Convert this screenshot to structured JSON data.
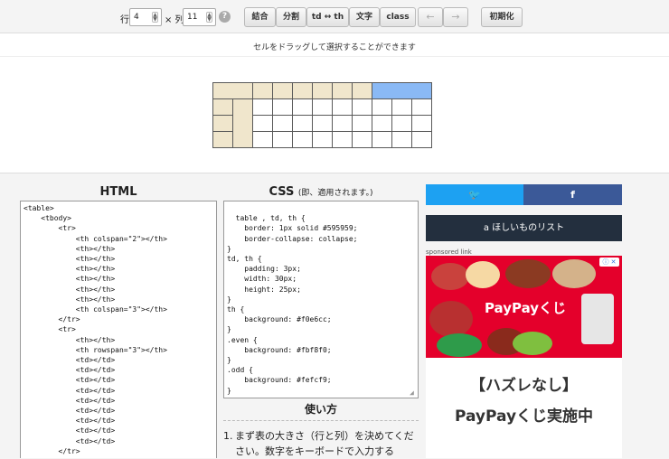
{
  "toolbar": {
    "rows_label": "行",
    "rows_value": "4",
    "times": "× 列",
    "cols_value": "11",
    "help": "?",
    "merge": "結合",
    "split": "分割",
    "td_th": "td ↔ th",
    "text": "文字",
    "class": "class",
    "undo": "←",
    "redo": "→",
    "reset": "初期化"
  },
  "hint": "セルをドラッグして選択することができます",
  "html_panel": {
    "title": "HTML",
    "code": "<table>\n    <tbody>\n        <tr>\n            <th colspan=\"2\"></th>\n            <th></th>\n            <th></th>\n            <th></th>\n            <th></th>\n            <th></th>\n            <th></th>\n            <th colspan=\"3\"></th>\n        </tr>\n        <tr>\n            <th></th>\n            <th rowspan=\"3\"></th>\n            <td></td>\n            <td></td>\n            <td></td>\n            <td></td>\n            <td></td>\n            <td></td>\n            <td></td>\n            <td></td>\n            <td></td>\n        </tr>"
  },
  "css_panel": {
    "title": "CSS",
    "note": "(即、適用されます。)",
    "code": "table , td, th {\n    border: 1px solid #595959;\n    border-collapse: collapse;\n}\ntd, th {\n    padding: 3px;\n    width: 30px;\n    height: 25px;\n}\nth {\n    background: #f0e6cc;\n}\n.even {\n    background: #fbf8f0;\n}\n.odd {\n    background: #fefcf9;\n}"
  },
  "usage": {
    "title": "使い方",
    "num": "1.",
    "text": "まず表の大きさ（行と列）を決めてください。数字をキーボードで入力する"
  },
  "share": {
    "twitter_icon": "twitter-icon",
    "facebook_icon": "facebook-icon",
    "twitter_glyph": "🐦",
    "facebook_glyph": "f"
  },
  "wishlist": "a ほしいものリスト",
  "sponsor": "sponsored link",
  "ad": {
    "badge": "ⓘ ✕",
    "paypay": "PayPayくじ",
    "headline1": "【ハズレなし】",
    "headline2": "PayPayくじ実施中"
  },
  "colors": {
    "th": "#f0e6cc",
    "selected": "#8ab9f5",
    "twitter": "#1da1f2",
    "facebook": "#3b5998",
    "wishlist": "#232f3e",
    "ad_red": "#e4002b"
  }
}
